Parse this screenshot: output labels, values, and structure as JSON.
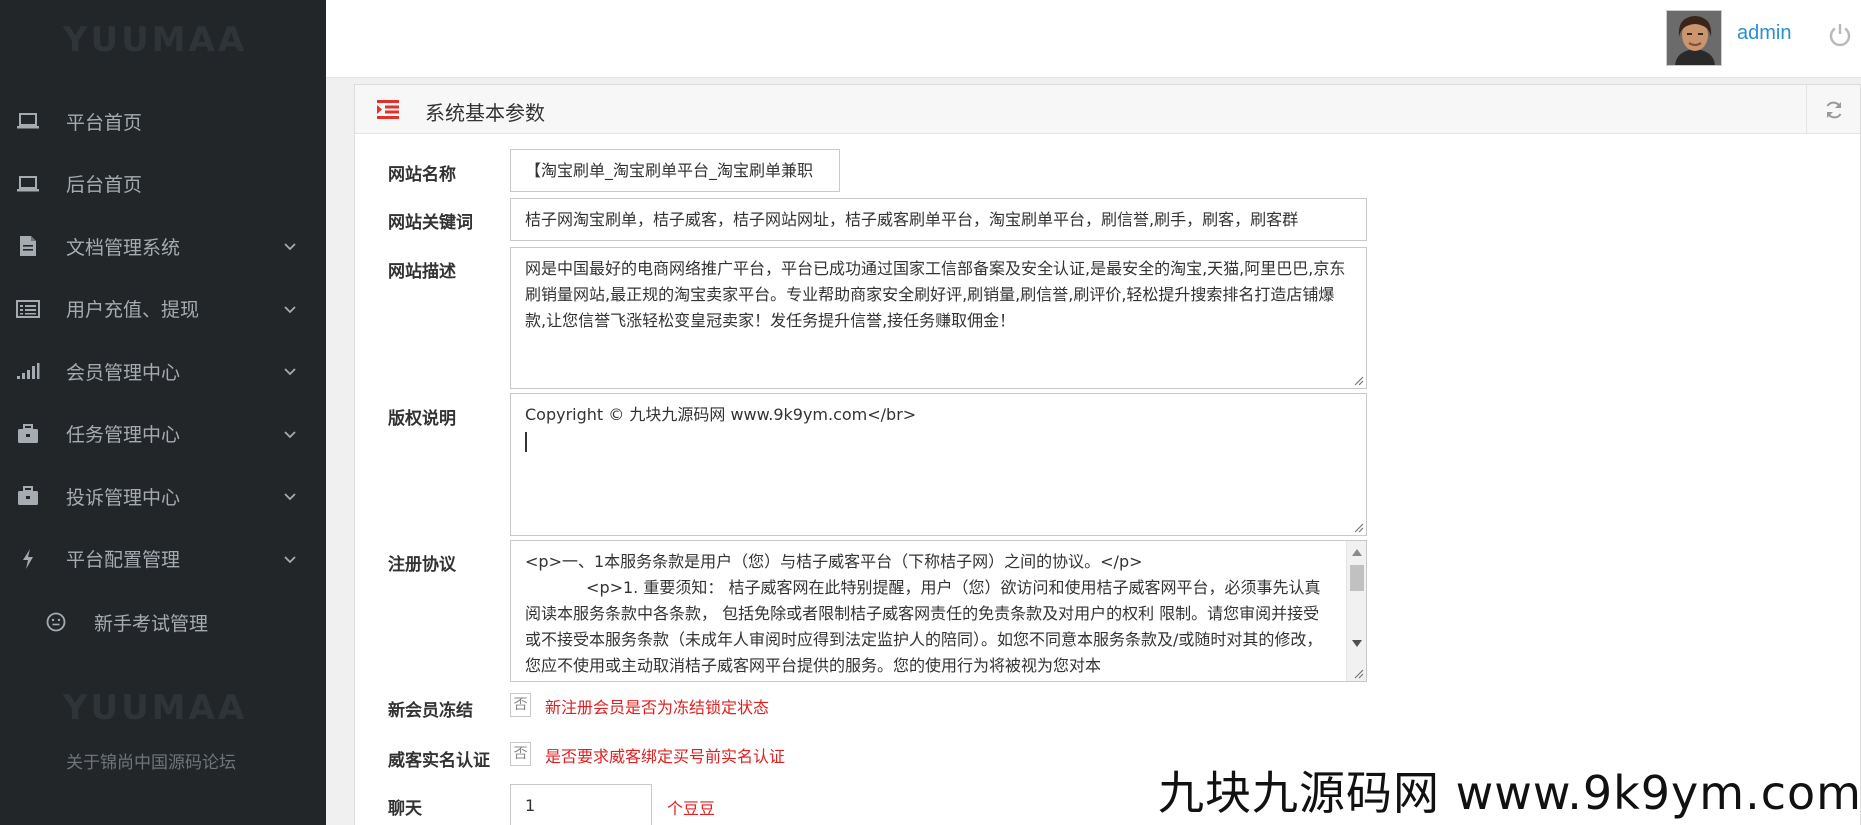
{
  "sidebar": {
    "logo": "YUUMAA",
    "items": [
      {
        "label": "平台首页",
        "icon": "laptop-icon"
      },
      {
        "label": "后台首页",
        "icon": "laptop-icon"
      },
      {
        "label": "文档管理系统",
        "icon": "document-icon"
      },
      {
        "label": "用户充值、提现",
        "icon": "list-icon"
      },
      {
        "label": "会员管理中心",
        "icon": "signal-icon"
      },
      {
        "label": "任务管理中心",
        "icon": "briefcase-icon"
      },
      {
        "label": "投诉管理中心",
        "icon": "briefcase-icon"
      },
      {
        "label": "平台配置管理",
        "icon": "bolt-icon"
      }
    ],
    "subitem": {
      "label": "新手考试管理",
      "icon": "smile-icon"
    },
    "footer_logo": "YUUMAA",
    "footer_text": "关于锦尚中国源码论坛"
  },
  "header": {
    "username": "admin"
  },
  "panel": {
    "title": "系统基本参数",
    "fields": {
      "site_name": {
        "label": "网站名称",
        "value": "【淘宝刷单_淘宝刷单平台_淘宝刷单兼职"
      },
      "keywords": {
        "label": "网站关键词",
        "value": "桔子网淘宝刷单，桔子威客，桔子网站网址，桔子威客刷单平台，淘宝刷单平台，刷信誉,刷手，刷客，刷客群"
      },
      "description": {
        "label": "网站描述",
        "value": "网是中国最好的电商网络推广平台，平台已成功通过国家工信部备案及安全认证,是最安全的淘宝,天猫,阿里巴巴,京东刷销量网站,最正规的淘宝卖家平台。专业帮助商家安全刷好评,刷销量,刷信誉,刷评价,轻松提升搜索排名打造店铺爆款,让您信誉飞涨轻松变皇冠卖家！发任务提升信誉,接任务赚取佣金！"
      },
      "copyright": {
        "label": "版权说明",
        "value": "Copyright © 九块九源码网 www.9k9ym.com</br>"
      },
      "agreement": {
        "label": "注册协议",
        "lines": [
          "<p>一、1本服务条款是用户（您）与桔子威客平台（下称桔子网）之间的协议。</p>",
          "            <p>1. 重要须知： 桔子威客网在此特别提醒，用户（您）欲访问和使用桔子威客网平台，必须事先认真阅读本服务条款中各条款， 包括免除或者限制桔子威客网责任的免责条款及对用户的权利 限制。请您审阅并接受或不接受本服务条款（未成年人审阅时应得到法定监护人的陪同）。如您不同意本服务条款及/或随时对其的修改，您应不使用或主动取消桔子威客网平台提供的服务。您的使用行为将被视为您对本"
        ]
      },
      "freeze": {
        "label": "新会员冻结",
        "value": "否",
        "hint": "新注册会员是否为冻结锁定状态"
      },
      "realname": {
        "label": "威客实名认证",
        "value": "否",
        "hint": "是否要求威客绑定买号前实名认证"
      },
      "chat": {
        "label": "聊天",
        "value": "1",
        "unit": "个豆豆"
      }
    }
  },
  "watermark": "九块九源码网 www.9k9ym.com"
}
